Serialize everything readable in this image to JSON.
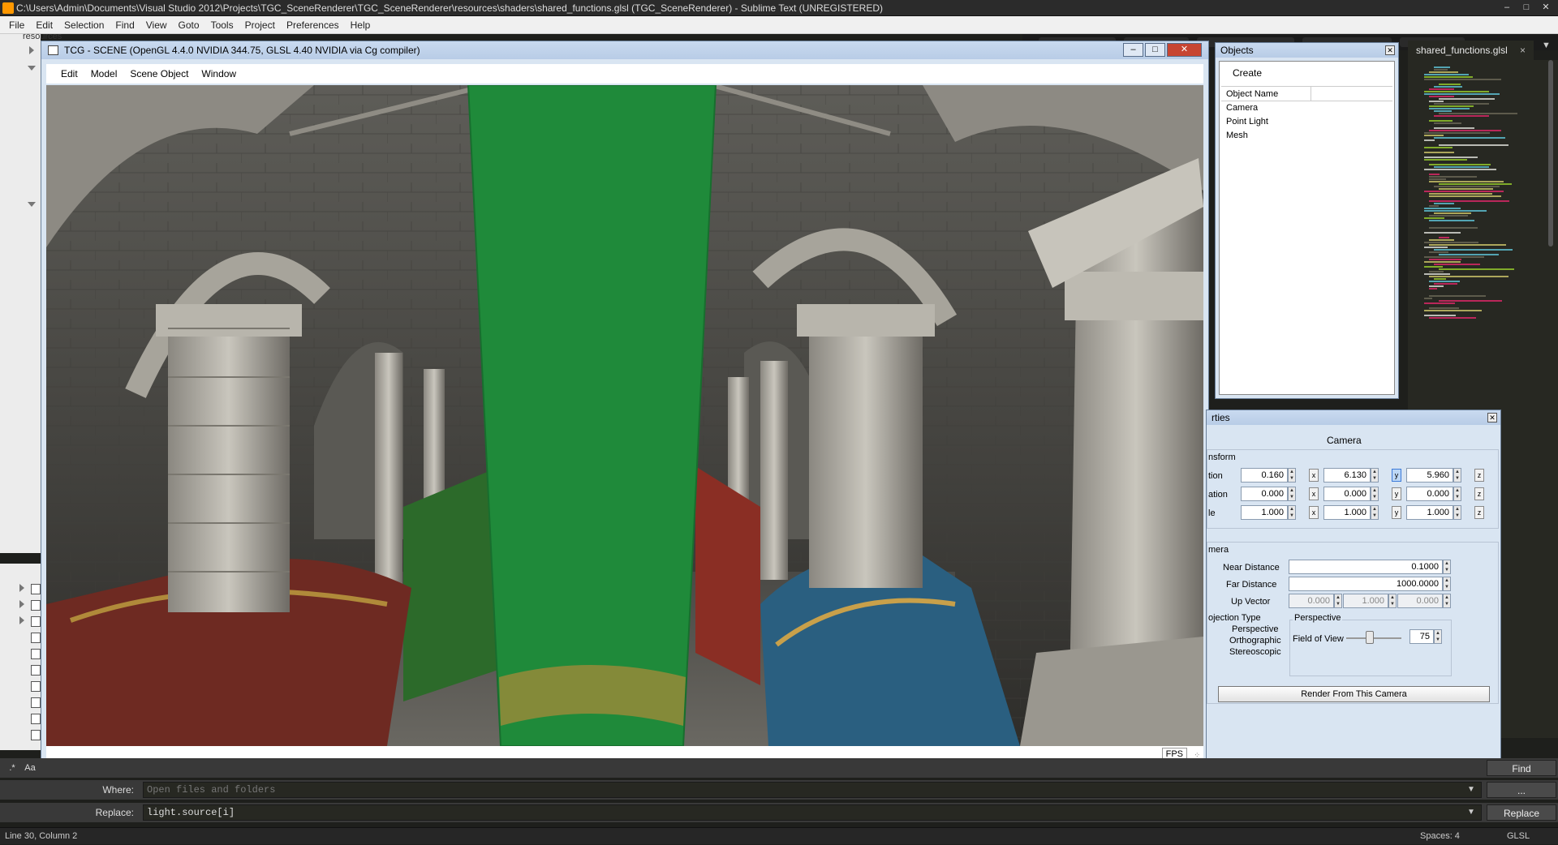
{
  "sublime": {
    "title": "C:\\Users\\Admin\\Documents\\Visual Studio 2012\\Projects\\TGC_SceneRenderer\\TGC_SceneRenderer\\resources\\shaders\\shared_functions.glsl (TGC_SceneRenderer) - Sublime Text (UNREGISTERED)",
    "menu": [
      "File",
      "Edit",
      "Selection",
      "Find",
      "View",
      "Goto",
      "Tools",
      "Project",
      "Preferences",
      "Help"
    ],
    "sidebar_folder": "resources",
    "active_tab": "shared_functions.glsl",
    "find_button": "Find",
    "where_label": "Where:",
    "where_placeholder": "Open files and folders",
    "where_button": "...",
    "replace_label": "Replace:",
    "replace_value": "light.source[i]",
    "replace_button": "Replace",
    "status": {
      "position": "Line 30, Column 2",
      "spaces": "Spaces: 4",
      "syntax": "GLSL"
    }
  },
  "tcg": {
    "title": "TCG - SCENE (OpenGL 4.4.0 NVIDIA 344.75, GLSL 4.40 NVIDIA via Cg compiler)",
    "menu": [
      "Edit",
      "Model",
      "Scene Object",
      "Window"
    ],
    "fps_label": "FPS"
  },
  "objects_panel": {
    "title": "Objects",
    "create_label": "Create",
    "column_header": "Object Name",
    "items": [
      "Camera",
      "Point Light",
      "Mesh"
    ]
  },
  "properties_panel": {
    "title": "rties",
    "object_name": "Camera",
    "transform_label": "nsform",
    "position_label": "tion",
    "rotation_label": "ation",
    "scale_label": "le",
    "position": [
      "0.160",
      "6.130",
      "5.960"
    ],
    "rotation": [
      "0.000",
      "0.000",
      "0.000"
    ],
    "scale": [
      "1.000",
      "1.000",
      "1.000"
    ],
    "axes": [
      "x",
      "y",
      "z"
    ],
    "camera_label": "mera",
    "near_label": "Near Distance",
    "near_value": "0.1000",
    "far_label": "Far Distance",
    "far_value": "1000.0000",
    "up_label": "Up Vector",
    "up_vector": [
      "0.000",
      "1.000",
      "0.000"
    ],
    "projection_label": "ojection Type",
    "projection_options": [
      "Perspective",
      "Orthographic",
      "Stereoscopic"
    ],
    "perspective_group": "Perspective",
    "fov_label": "Field of View",
    "fov_value": "75",
    "fov_slider_fraction": 0.42,
    "render_button": "Render From This Camera"
  }
}
